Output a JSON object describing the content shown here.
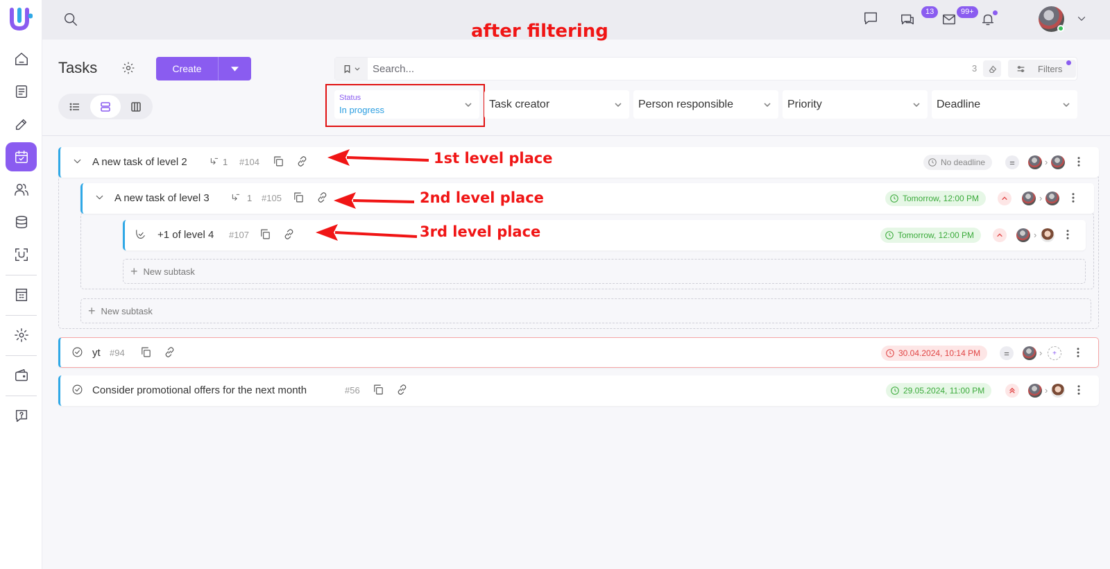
{
  "annotation": {
    "title": "after filtering",
    "level1": "1st level place",
    "level2": "2nd level place",
    "level3": "3rd level place"
  },
  "topbar": {
    "chat_badge": "13",
    "mail_badge": "99+"
  },
  "page": {
    "title": "Tasks",
    "create_label": "Create"
  },
  "search": {
    "placeholder": "Search...",
    "count": "3",
    "filters_label": "Filters"
  },
  "filters": {
    "status_label": "Status",
    "status_value": "In progress",
    "task_creator": "Task creator",
    "person_responsible": "Person responsible",
    "priority": "Priority",
    "deadline": "Deadline"
  },
  "tasks": [
    {
      "title": "A new task of level 2",
      "subtasks": "1",
      "id": "#104",
      "deadline": "No deadline",
      "priority": "="
    },
    {
      "title": "A new task of level 3",
      "subtasks": "1",
      "id": "#105",
      "deadline": "Tomorrow, 12:00 PM",
      "priority": "^"
    },
    {
      "title": "+1 of level 4",
      "id": "#107",
      "deadline": "Tomorrow, 12:00 PM",
      "priority": "^"
    },
    {
      "title": "yt",
      "id": "#94",
      "deadline": "30.04.2024, 10:14 PM",
      "priority": "="
    },
    {
      "title": "Consider promotional offers for the next month",
      "id": "#56",
      "deadline": "29.05.2024, 11:00 PM",
      "priority": "^^"
    }
  ],
  "new_subtask_label": "New subtask",
  "colors": {
    "accent": "#8a5cf0",
    "task_border": "#2fa8e6",
    "annotation": "#f01515"
  }
}
